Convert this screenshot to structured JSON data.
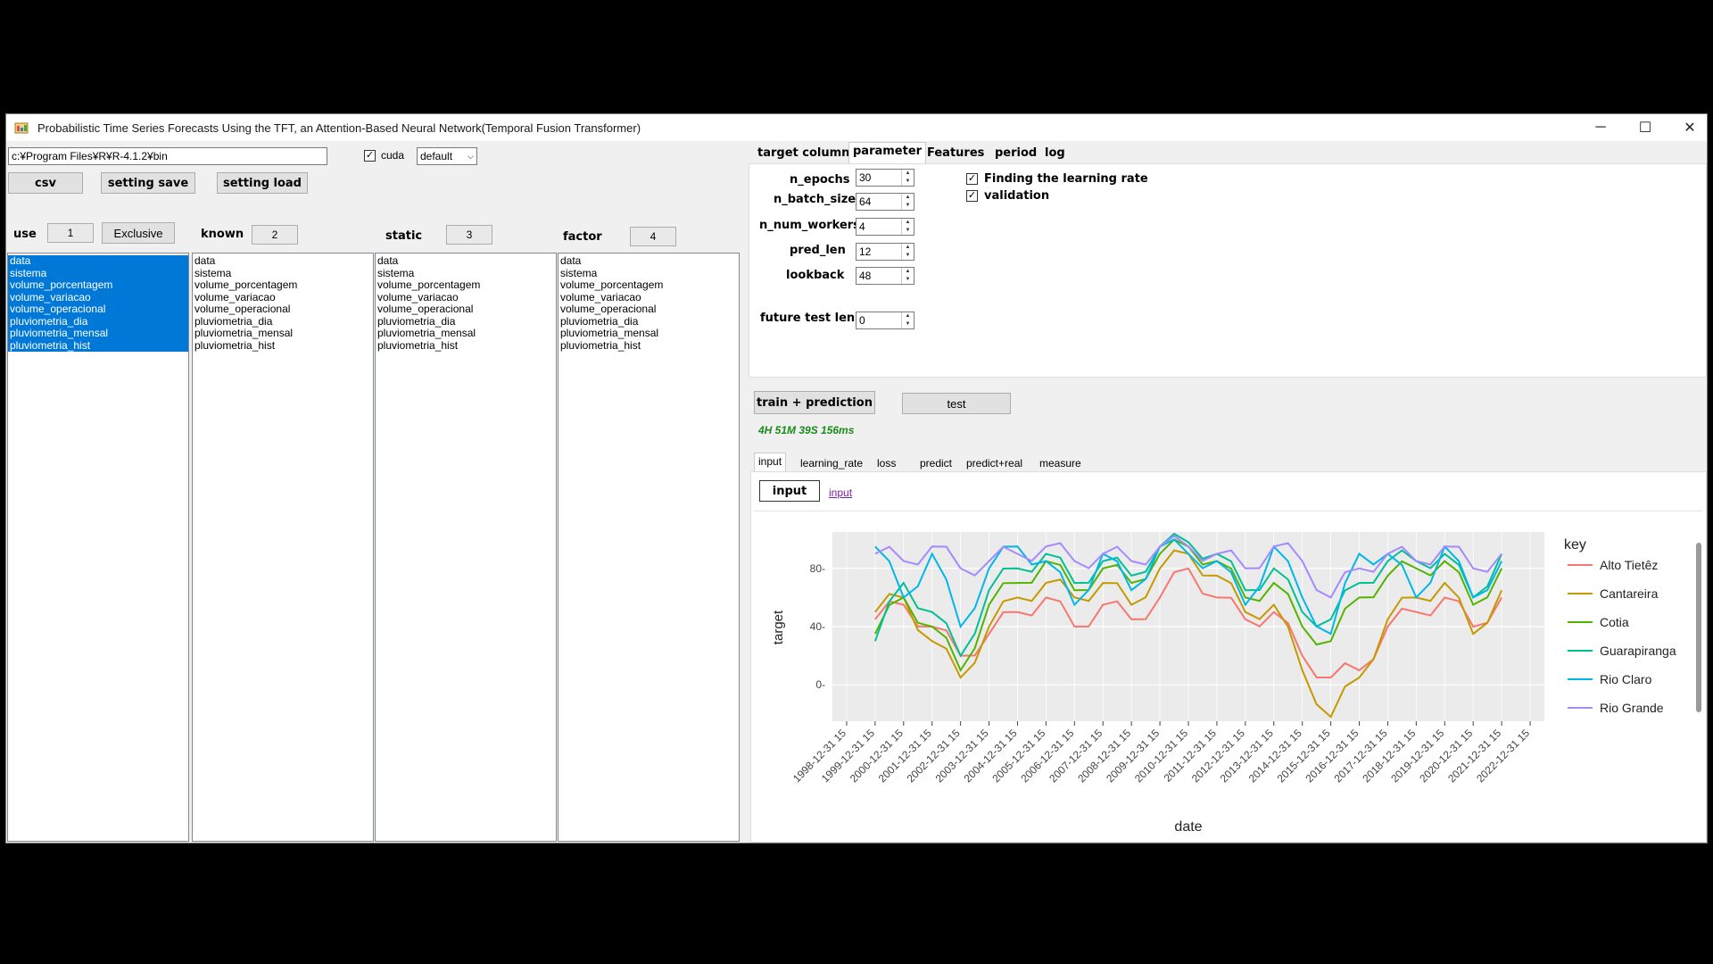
{
  "window": {
    "title": "Probabilistic Time Series Forecasts Using the TFT, an Attention-Based Neural Network(Temporal Fusion Transformer)",
    "minimize": "─",
    "maximize": "☐",
    "close": "✕"
  },
  "toolbar": {
    "path": "c:¥Program Files¥R¥R-4.1.2¥bin",
    "cuda_label": "cuda",
    "cuda_checked": true,
    "device_select": "default",
    "csv": "csv",
    "setting_save": "setting save",
    "setting_load": "setting load"
  },
  "columns": [
    {
      "label": "use",
      "badge": "1",
      "extra_button": "Exclusive",
      "selected": true
    },
    {
      "label": "known",
      "badge": "2",
      "selected": false
    },
    {
      "label": "static",
      "badge": "3",
      "selected": false
    },
    {
      "label": "factor",
      "badge": "4",
      "selected": false
    }
  ],
  "variables": [
    "data",
    "sistema",
    "volume_porcentagem",
    "volume_variacao",
    "volume_operacional",
    "pluviometria_dia",
    "pluviometria_mensal",
    "pluviometria_hist"
  ],
  "settings_tabs": [
    "target column",
    "parameter",
    "Features",
    "period",
    "log"
  ],
  "active_settings_tab": "parameter",
  "parameters": {
    "n_epochs_label": "n_epochs",
    "n_epochs": "30",
    "n_batch_size_label": "n_batch_size",
    "n_batch_size": "64",
    "n_num_workers_label": "n_num_workers",
    "n_num_workers": "4",
    "pred_len_label": "pred_len",
    "pred_len": "12",
    "lookback_label": "lookback",
    "lookback": "48",
    "future_test_len_label": "future test len",
    "future_test_len": "0",
    "finding_lr_label": "Finding the learning rate",
    "validation_label": "validation"
  },
  "actions": {
    "train_prediction": "train + prediction",
    "test": "test",
    "elapsed": "4H 51M 39S 156ms"
  },
  "result_tabs": [
    "input",
    "learning_rate",
    "loss",
    "predict",
    "predict+real",
    "measure"
  ],
  "active_result_tab": "input",
  "input_panel": {
    "button": "input",
    "link": "input"
  },
  "chart_data": {
    "type": "line",
    "xlabel": "date",
    "ylabel": "target",
    "legend_title": "key",
    "legend_position": "right",
    "grid": true,
    "ylim": [
      -25,
      105
    ],
    "yticks": [
      0,
      40,
      80
    ],
    "x_tick_labels": [
      "1998-12-31 15",
      "1999-12-31 15",
      "2000-12-31 15",
      "2001-12-31 15",
      "2002-12-31 15",
      "2003-12-31 15",
      "2004-12-31 15",
      "2005-12-31 15",
      "2006-12-31 15",
      "2007-12-31 15",
      "2008-12-31 15",
      "2009-12-31 15",
      "2010-12-31 15",
      "2011-12-31 15",
      "2012-12-31 15",
      "2013-12-31 15",
      "2014-12-31 15",
      "2015-12-31 15",
      "2016-12-31 15",
      "2017-12-31 15",
      "2018-12-31 15",
      "2019-12-31 15",
      "2020-12-31 15",
      "2021-12-31 15",
      "2022-12-31 15"
    ],
    "x": [
      "2000-01",
      "2001-01",
      "2002-01",
      "2003-01",
      "2004-01",
      "2005-01",
      "2006-01",
      "2007-01",
      "2008-01",
      "2009-01",
      "2010-01",
      "2011-01",
      "2012-01",
      "2013-01",
      "2014-01",
      "2015-01",
      "2016-01",
      "2017-01",
      "2018-01",
      "2019-01",
      "2020-01",
      "2021-01",
      "2022-01"
    ],
    "series": [
      {
        "name": "Alto Tietêz",
        "color": "#f8766d",
        "values": [
          45,
          55,
          40,
          20,
          35,
          50,
          60,
          40,
          55,
          45,
          60,
          80,
          60,
          45,
          50,
          20,
          5,
          10,
          40,
          50,
          60,
          40,
          60
        ]
      },
      {
        "name": "Cantareira",
        "color": "#c49a00",
        "values": [
          50,
          60,
          30,
          5,
          40,
          60,
          70,
          60,
          70,
          55,
          80,
          90,
          75,
          50,
          55,
          10,
          -22,
          5,
          45,
          60,
          70,
          35,
          65
        ]
      },
      {
        "name": "Cotia",
        "color": "#53b400",
        "values": [
          35,
          60,
          40,
          10,
          55,
          70,
          85,
          65,
          80,
          70,
          90,
          95,
          85,
          60,
          70,
          40,
          30,
          60,
          75,
          80,
          85,
          55,
          80
        ]
      },
      {
        "name": "Guarapiranga",
        "color": "#00c094",
        "values": [
          30,
          70,
          50,
          20,
          65,
          80,
          90,
          70,
          85,
          75,
          95,
          98,
          90,
          65,
          80,
          50,
          45,
          70,
          85,
          85,
          90,
          60,
          90
        ]
      },
      {
        "name": "Rio Claro",
        "color": "#00b6eb",
        "values": [
          95,
          60,
          90,
          40,
          80,
          95,
          85,
          55,
          90,
          65,
          95,
          90,
          85,
          55,
          95,
          60,
          35,
          90,
          90,
          60,
          95,
          60,
          85
        ]
      },
      {
        "name": "Rio Grande",
        "color": "#a58aff",
        "values": [
          90,
          85,
          95,
          80,
          85,
          90,
          95,
          85,
          90,
          85,
          95,
          95,
          90,
          80,
          95,
          85,
          60,
          80,
          90,
          85,
          95,
          80,
          90
        ]
      }
    ]
  }
}
